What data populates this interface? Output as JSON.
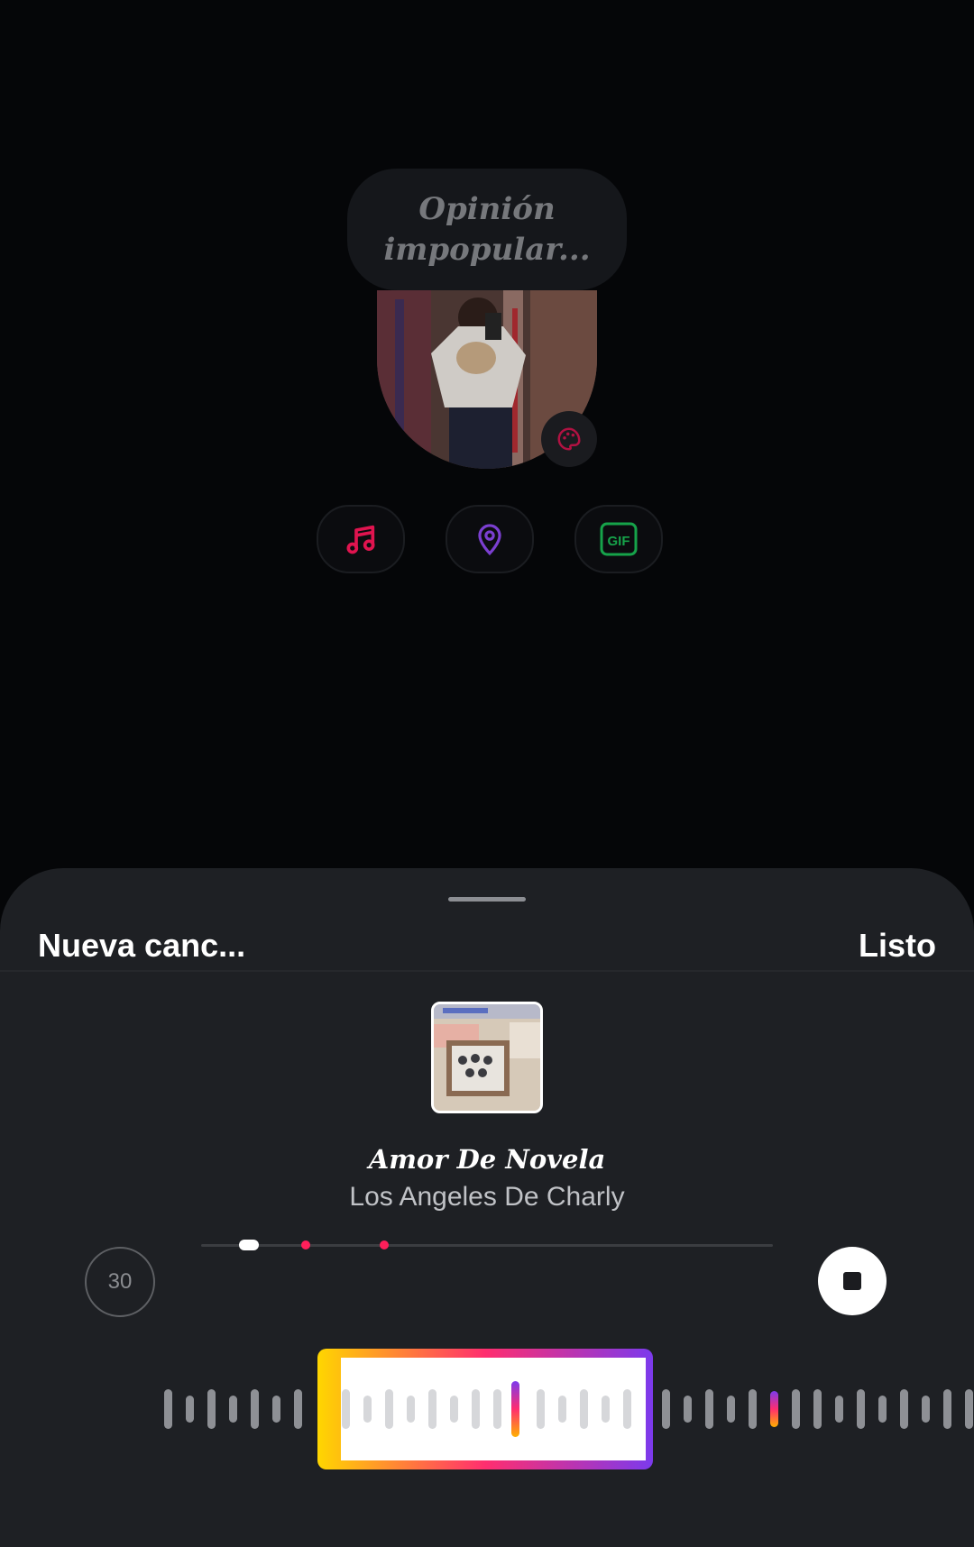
{
  "story": {
    "prompt_text": "Opinión impopular...",
    "stickers": [
      {
        "name": "music-note-icon",
        "color": "#e0144f"
      },
      {
        "name": "location-pin-icon",
        "color": "#7b3fd0"
      },
      {
        "name": "gif-icon",
        "label": "GIF",
        "color": "#16a34a"
      }
    ],
    "palette_icon_color": "#b01242"
  },
  "sheet": {
    "title": "Nueva canc...",
    "done_label": "Listo"
  },
  "song": {
    "title": "Amor De Novela",
    "artist": "Los Angeles De Charly"
  },
  "player": {
    "duration_label": "30",
    "progress": 0.08
  },
  "colors": {
    "accent_pink": "#ff1f5a",
    "selection_gradient": [
      "#ffd600",
      "#ff2e6f",
      "#7c3aed"
    ]
  }
}
